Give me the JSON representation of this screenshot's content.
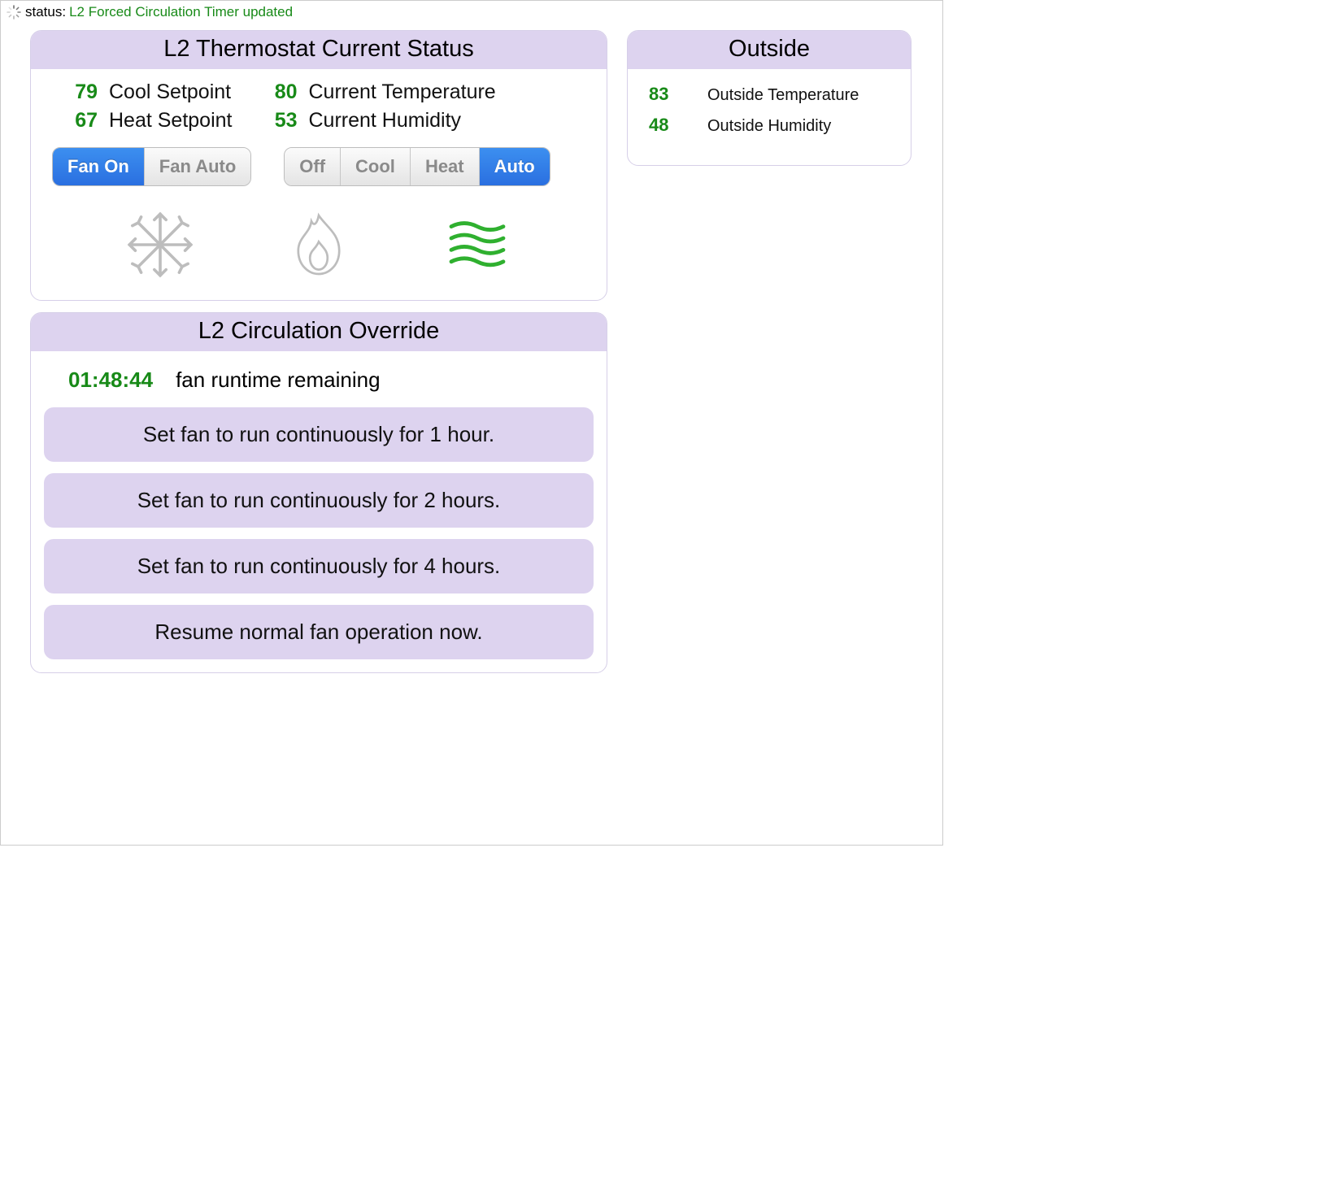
{
  "status": {
    "label": "status:",
    "message": "L2 Forced Circulation Timer updated"
  },
  "thermostat": {
    "title": "L2 Thermostat Current Status",
    "cool_setpoint": {
      "value": "79",
      "label": "Cool Setpoint"
    },
    "heat_setpoint": {
      "value": "67",
      "label": "Heat Setpoint"
    },
    "current_temp": {
      "value": "80",
      "label": "Current Temperature"
    },
    "current_hum": {
      "value": "53",
      "label": "Current Humidity"
    },
    "fan_segments": [
      {
        "label": "Fan On",
        "active": true
      },
      {
        "label": "Fan Auto",
        "active": false
      }
    ],
    "mode_segments": [
      {
        "label": "Off",
        "active": false
      },
      {
        "label": "Cool",
        "active": false
      },
      {
        "label": "Heat",
        "active": false
      },
      {
        "label": "Auto",
        "active": true
      }
    ]
  },
  "override": {
    "title": "L2 Circulation Override",
    "runtime_value": "01:48:44",
    "runtime_label": "fan runtime remaining",
    "buttons": [
      "Set fan to run continuously for 1 hour.",
      "Set fan to run continuously for 2 hours.",
      "Set fan to run continuously for 4 hours.",
      "Resume normal fan operation now."
    ]
  },
  "outside": {
    "title": "Outside",
    "temp": {
      "value": "83",
      "label": "Outside Temperature"
    },
    "hum": {
      "value": "48",
      "label": "Outside Humidity"
    }
  }
}
